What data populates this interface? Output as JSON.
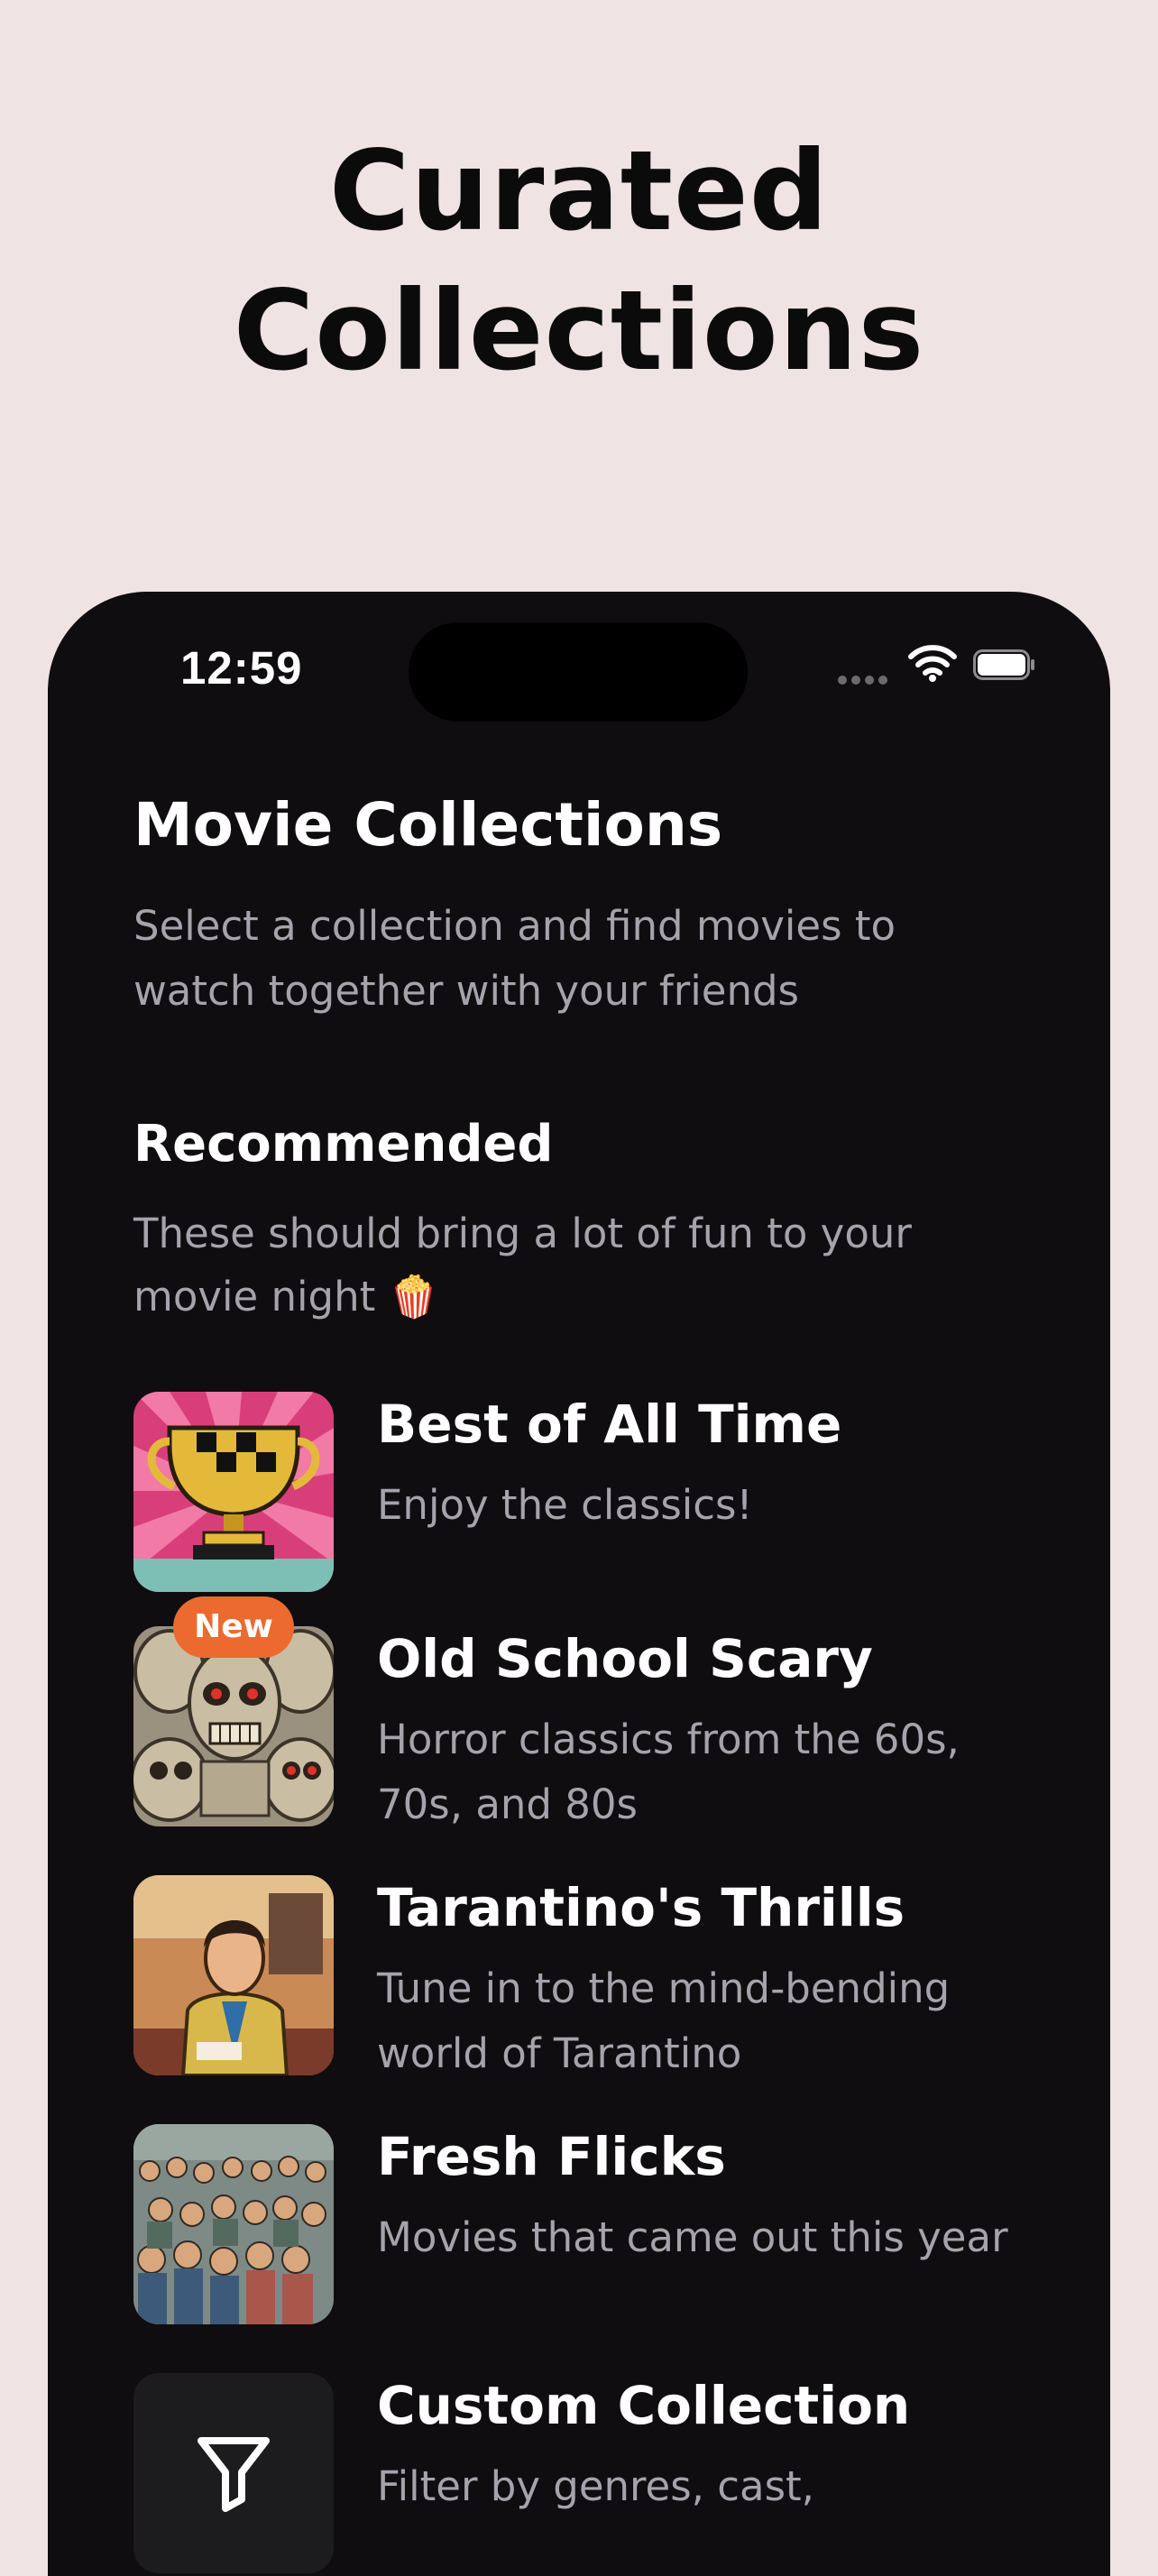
{
  "headline": {
    "line1": "Curated",
    "line2": "Collections"
  },
  "status_bar": {
    "time": "12:59"
  },
  "page": {
    "title": "Movie Collections",
    "subtitle": "Select a collection and find movies to watch together with your friends"
  },
  "recommended": {
    "title": "Recommended",
    "subtitle": "These should bring a lot of fun to your movie night 🍿"
  },
  "collections": [
    {
      "title": "Best of All Time",
      "description": "Enjoy the classics!",
      "icon": "trophy-artwork"
    },
    {
      "title": "Old School Scary",
      "description": "Horror classics from the 60s, 70s, and 80s",
      "badge": "New",
      "icon": "zombie-faces-artwork"
    },
    {
      "title": "Tarantino's Thrills",
      "description": "Tune in to the mind-bending world of Tarantino",
      "icon": "man-portrait-artwork"
    },
    {
      "title": "Fresh Flicks",
      "description": "Movies that came out this year",
      "icon": "crowd-artwork"
    },
    {
      "title": "Custom Collection",
      "description": "Filter by genres, cast,",
      "icon": "filter-icon"
    }
  ],
  "colors": {
    "background": "#efe3e3",
    "phone_bg": "#0f0d10",
    "text_primary": "#ffffff",
    "text_secondary": "#a5a3ab",
    "badge": "#ec6a30"
  }
}
